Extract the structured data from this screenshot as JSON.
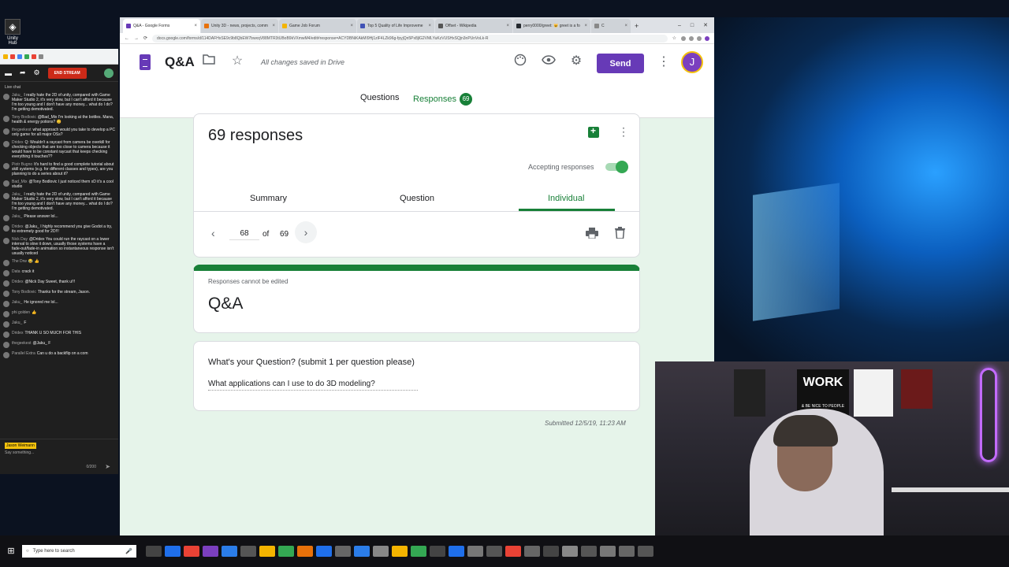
{
  "desktop": {
    "unity_hub_label": "Unity Hub"
  },
  "chat": {
    "end_stream_label": "END STREAM",
    "live_chat_label": "Live chat",
    "messages": [
      {
        "name": "Jaku_",
        "text": "I really hate the 2D of unity, compared with Game Maker Studio 2, it's very slow, but I can't afford it because I'm too young and I don't have any money... what do I do? I'm getting demotivated."
      },
      {
        "name": "Tony Bodlovic",
        "text": "@Bad_Mix I'm looking at the bottles. Mana, health & energy potions? 😊"
      },
      {
        "name": "thegeekest",
        "text": "what approach would you take to develop a PC only game for all major OSs?"
      },
      {
        "name": "Dridex",
        "text": "Q: Wouldn't a raycast from camera be overkill for checking objects that are too close to camera because it would have to be constant raycast that keeps checking everything it touches??"
      },
      {
        "name": "Piotr Bugno",
        "text": "It's hard to find a good complete tutorial about skill systems (e.g. for different classes and types), are you planning to do a series about it?"
      },
      {
        "name": "Bad_Mix",
        "text": "@Tony Bodlovic I just noticed them xD it's a cool studio"
      },
      {
        "name": "Jaku_",
        "text": "I really hate the 2D of unity, compared with Game Maker Studio 2, it's very slow, but I can't afford it because I'm too young and I don't have any money... what do I do? I'm getting demotivated."
      },
      {
        "name": "Jaku_",
        "text": "Please answer lol..."
      },
      {
        "name": "Dridex",
        "text": "@Jaku_ I highly recommend you give Godot a try, its extremely good for 2D!!!"
      },
      {
        "name": "Nick Day",
        "text": "@Dridex You could run the raycast on a lower interval to slow it down, usually those systems have a fade-out/fade-in animation so instantaneous response isn't usually noticed"
      },
      {
        "name": "The Drw",
        "text": "😂 👍"
      },
      {
        "name": "Data",
        "text": "crack it"
      },
      {
        "name": "Dridex",
        "text": "@Nick Day Sweet, thank u!!!"
      },
      {
        "name": "Tony Bodlovic",
        "text": "Thanks for the stream, Jason."
      },
      {
        "name": "Jaku_",
        "text": "He ignored me lol..."
      },
      {
        "name": "phi golden",
        "text": "👍"
      },
      {
        "name": "Jaku_",
        "text": "F"
      },
      {
        "name": "Dridex",
        "text": "THANK U SO MUCH FOR THIS"
      },
      {
        "name": "thegeekest",
        "text": "@Jaku_ F"
      },
      {
        "name": "Parallel Extra",
        "text": "Can u do a backflip on a com"
      }
    ],
    "current_user": "Jason Weimann",
    "input_placeholder": "Say something...",
    "char_count": "0/200"
  },
  "browser": {
    "tabs": [
      {
        "label": "Q&A - Google Forms",
        "color": "#673ab7",
        "active": true
      },
      {
        "label": "Unity 3D - news, projects, comm",
        "color": "#e8710a",
        "active": false
      },
      {
        "label": "Game Job Forum",
        "color": "#f4b400",
        "active": false
      },
      {
        "label": "Top 5 Quality of Life Improveme",
        "color": "#3f51b5",
        "active": false
      },
      {
        "label": "Offset - Wikipedia",
        "color": "#555555",
        "active": false
      },
      {
        "label": "perry0000/greet: 😺 greet is a fo",
        "color": "#24292e",
        "active": false
      },
      {
        "label": "C",
        "color": "#888888",
        "active": false
      }
    ],
    "url": "docs.google.com/forms/d/114DAFHxSE9c9b8QbEW7bwxqV88MTR3tUBoB9kVXmwM4/edit#response=ACYDBNiKAkMI9Hj1zlF4LZk96g-fpyjQn5Px8jlG2VMLYuKzVUSHxSQjn3nPUnVoLk-R"
  },
  "forms": {
    "title": "Q&A",
    "saved_status": "All changes saved in Drive",
    "send_label": "Send",
    "profile_initial": "J",
    "tab_questions": "Questions",
    "tab_responses": "Responses",
    "responses_badge": "69",
    "responses_heading": "69 responses",
    "accepting_label": "Accepting responses",
    "accepting": true,
    "sub_tabs": {
      "summary": "Summary",
      "question": "Question",
      "individual": "Individual"
    },
    "pager": {
      "current": "68",
      "of_label": "of",
      "total": "69"
    },
    "cannot_edit": "Responses cannot be edited",
    "form_name": "Q&A",
    "question": "What's your Question? (submit 1 per question please)",
    "answer": "What applications can I use to do 3D modeling?",
    "submitted": "Submitted 12/5/19, 11:23 AM"
  },
  "webcam": {
    "poster_text": "WORK",
    "poster_subtext": "& BE NICE TO PEOPLE"
  },
  "taskbar": {
    "search_placeholder": "Type here to search"
  },
  "colors": {
    "forms_purple": "#673ab7",
    "forms_green": "#188038",
    "form_bg": "#e6f4ea"
  }
}
